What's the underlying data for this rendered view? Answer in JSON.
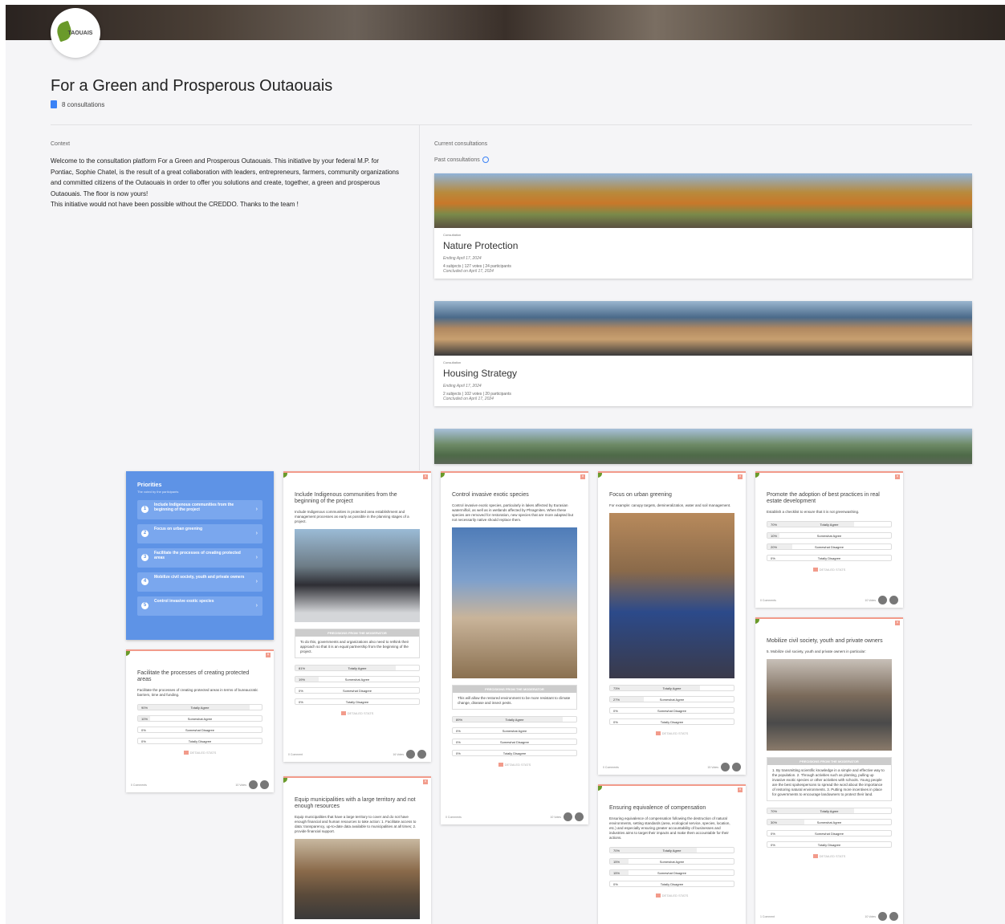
{
  "header": {
    "logo_text": "TAOUAIS",
    "title": "For a Green and Prosperous Outaouais",
    "consultations_count": "8 consultations"
  },
  "context": {
    "label": "Context",
    "paragraph1": "Welcome to the consultation platform For a Green and Prosperous Outaouais. This initiative by your federal M.P. for Pontiac, Sophie Chatel, is the result of a great collaboration with leaders, entrepreneurs, farmers, community organizations and committed citizens of the Outaouais in order to offer you solutions and create, together, a green and prosperous Outaouais. The floor is now yours!",
    "paragraph2": "This initiative would not have been possible without the CREDDO. Thanks to the team !"
  },
  "consultations": {
    "current_label": "Current consultations",
    "past_label": "Past consultations",
    "cards": [
      {
        "type": "Consultation",
        "name": "Nature Protection",
        "ending": "Ending April 17, 2024",
        "stats": "4 subjects | 127 votes | 24 participants",
        "concluded": "Concluded on April 17, 2024"
      },
      {
        "type": "Consultation",
        "name": "Housing Strategy",
        "ending": "Ending April 17, 2024",
        "stats": "2 subjects | 102 votes | 20 participants",
        "concluded": "Concluded on April 17, 2024"
      }
    ]
  },
  "priorities": {
    "title": "Priorities",
    "subtitle": "The voted by the participants",
    "items": [
      {
        "num": "1",
        "label": "Include Indigenous communities from the beginning of the project"
      },
      {
        "num": "2",
        "label": "Focus on urban greening"
      },
      {
        "num": "3",
        "label": "Facilitate the processes of creating protected areas"
      },
      {
        "num": "4",
        "label": "Mobilize civil society, youth and private owners"
      },
      {
        "num": "5",
        "label": "Control invasive exotic species"
      }
    ]
  },
  "common": {
    "moderator": "PRECISIONS FROM THE MODERATOR",
    "results": "DETAILED STATS",
    "opt1": "Totally Agree",
    "opt2": "Somewhat Agree",
    "opt3": "Somewhat Disagree",
    "opt4": "Totally Disagree"
  },
  "subjects": [
    {
      "id": "indigenous",
      "title": "Include Indigenous communities from the beginning of the project",
      "desc": "Include Indigenous communities in protected area establishment and management processes as early as possible in the planning stages of a project.",
      "moderator_text": "To do this, governments and organizations also need to rethink their approach so that it is an equal partnership from the beginning of the project.",
      "bars": [
        "81%",
        "19%",
        "0%",
        "0%"
      ],
      "bar_fill": [
        0.81,
        0.19,
        0,
        0
      ],
      "comments": "0 Comment",
      "votes": "16 Votes"
    },
    {
      "id": "invasive",
      "title": "Control invasive exotic species",
      "desc": "Control invasive exotic species, particularly in lakes affected by Eurasian watermilfoil, as well as in wetlands affected by Phragmites. When these species are removed for restoration, new species that are more adapted but not necessarily native should replace them.",
      "moderator_text": "This will allow the restored environment to be more resistant to climate change, disease and insect pests.",
      "bars": [
        "89%",
        "0%",
        "0%",
        "0%"
      ],
      "bar_fill": [
        0.89,
        0,
        0,
        0
      ],
      "comments": "0 Comments",
      "votes": "10 Votes"
    },
    {
      "id": "urban",
      "title": "Focus on urban greening",
      "desc": "For example: canopy targets, demineralization, water and soil management.",
      "bars": [
        "73%",
        "27%",
        "0%",
        "0%"
      ],
      "bar_fill": [
        0.73,
        0.27,
        0,
        0
      ],
      "comments": "0 Comments",
      "votes": "15 Votes"
    },
    {
      "id": "realestate",
      "title": "Promote the adoption of best practices in real estate development",
      "desc": "Establish a checklist to ensure that it is not greenwashing.",
      "bars": [
        "70%",
        "10%",
        "20%",
        "0%"
      ],
      "bar_fill": [
        0.7,
        0.1,
        0.2,
        0
      ],
      "comments": "0 Comments",
      "votes": "10 Votes"
    },
    {
      "id": "protected",
      "title": "Facilitate the processes of creating protected areas",
      "desc": "Facilitate the processes of creating protected areas in terms of bureaucratic barriers, time and funding.",
      "bars": [
        "90%",
        "10%",
        "0%",
        "0%"
      ],
      "bar_fill": [
        0.9,
        0.1,
        0,
        0
      ],
      "comments": "0 Comments",
      "votes": "10 Votes"
    },
    {
      "id": "mobilize",
      "title": "Mobilize civil society, youth and private owners",
      "desc": "5. Mobilize civil society, youth and private owners in particular:",
      "moderator_text": "1. By transmitting scientific knowledge in a simple and effective way to the population. 2. Through activities such as planting, pulling up invasive exotic species or other activities with schools. Young people are the best spokespersons to spread the word about the importance of restoring natural environments. 3. Putting more incentives in place for governments to encourage landowners to protect their land.",
      "bars": [
        "70%",
        "30%",
        "0%",
        "0%"
      ],
      "bar_fill": [
        0.7,
        0.3,
        0,
        0
      ],
      "comments": "1 Comment",
      "votes": "10 Votes"
    },
    {
      "id": "municipalities",
      "title": "Equip municipalities with a large territory and not enough resources",
      "desc": "Equip municipalities that have a large territory to cover and do not have enough financial and human resources to take action: 1. Facilitate access to data: transparency, up-to-date data available to municipalities at all times; 2. provide financial support."
    },
    {
      "id": "compensation",
      "title": "Ensuring equivalence of compensation",
      "desc": "Ensuring equivalence of compensation following the destruction of natural environments, setting standards (area, ecological service, species, location, etc.) and especially ensuring greater accountability of businesses and industries aims to target their impacts and make them accountable for their actions.",
      "bars": [
        "70%",
        "15%",
        "15%",
        "0%"
      ],
      "bar_fill": [
        0.7,
        0.15,
        0.15,
        0
      ]
    }
  ]
}
